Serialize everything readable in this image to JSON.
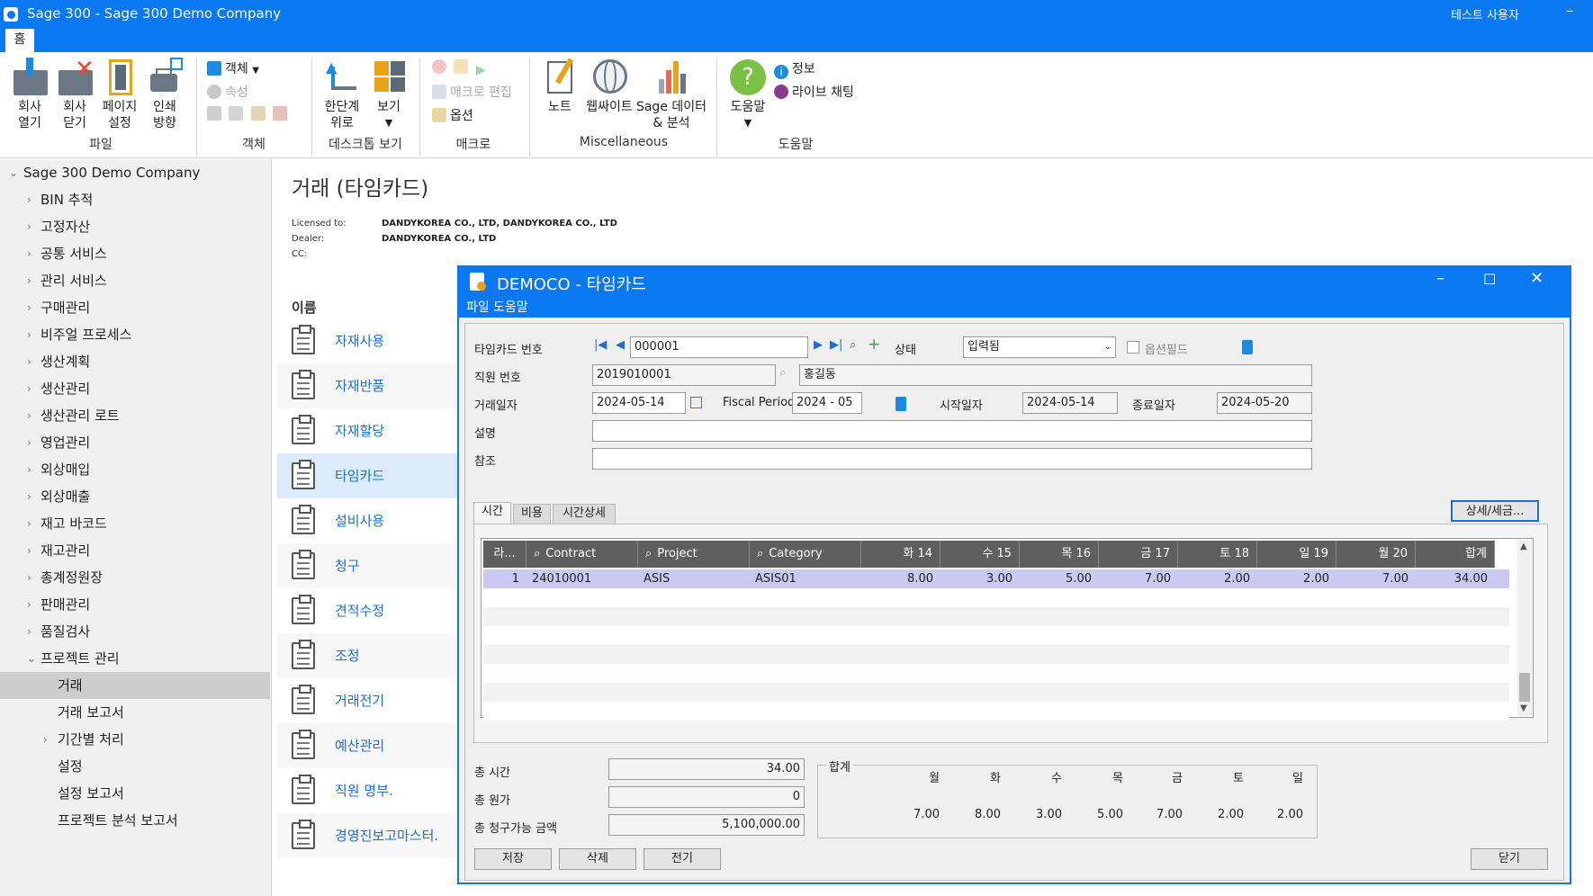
{
  "window": {
    "title": "Sage 300 - Sage 300 Demo Company",
    "user": "테스트 사용자",
    "minimize": "–"
  },
  "ribbon": {
    "tab_home": "홈",
    "file": {
      "open_company": "회사\n열기",
      "close_company": "회사\n닫기",
      "page_setup": "페이지\n설정",
      "print_dest": "인쇄\n방향",
      "group": "파일"
    },
    "object": {
      "object": "객체",
      "properties": "속성",
      "group": "객체"
    },
    "desktop": {
      "up_level": "한단계\n위로",
      "view": "보기",
      "group": "데스크톱 보기"
    },
    "macro": {
      "edit": "매크로 편집",
      "options": "옵션",
      "group": "매크로"
    },
    "misc": {
      "notes": "노트",
      "website": "웹싸이트",
      "sage_data": "Sage 데이터\n& 분석",
      "group": "Miscellaneous"
    },
    "help": {
      "help": "도움말",
      "info": "정보",
      "live_chat": "라이브 채팅",
      "group": "도움말"
    }
  },
  "sidebar": {
    "root": "Sage 300 Demo Company",
    "items": [
      "BIN 추적",
      "고정자산",
      "공통 서비스",
      "관리 서비스",
      "구매관리",
      "비주얼 프로세스",
      "생산계획",
      "생산관리",
      "생산관리 로트",
      "영업관리",
      "외상매입",
      "외상매출",
      "재고 바코드",
      "재고관리",
      "총계정원장",
      "판매관리",
      "품질검사",
      "프로젝트 관리"
    ],
    "sub": [
      "거래",
      "거래 보고서",
      "기간별 처리",
      "설정",
      "설정 보고서",
      "프로젝트 분석 보고서"
    ]
  },
  "page": {
    "title": "거래 (타임카드)",
    "licensed_to_label": "Licensed to:",
    "licensed_to": "DANDYKOREA CO., LTD, DANDYKOREA CO., LTD",
    "dealer_label": "Dealer:",
    "dealer": "DANDYKOREA CO., LTD",
    "cc_label": "CC:",
    "name_header": "이름",
    "items": [
      "자재사용",
      "자재반품",
      "자재할당",
      "타임카드",
      "설비사용",
      "청구",
      "견적수정",
      "조정",
      "거래전기",
      "예산관리",
      "직원 명부.",
      "경영진보고마스터."
    ]
  },
  "dialog": {
    "title": "DEMOCO - 타임카드",
    "menu": [
      "파일",
      "도움말"
    ],
    "timecard_no_label": "타임카드 번호",
    "timecard_no": "000001",
    "status_label": "상태",
    "status": "입력됨",
    "optional_fields": "옵션필드",
    "employee_label": "직원 번호",
    "employee_no": "2019010001",
    "employee_name": "홍길동",
    "trans_date_label": "거래일자",
    "trans_date": "2024-05-14",
    "fiscal_label": "Fiscal Period",
    "fiscal": "2024 - 05",
    "start_label": "시작일자",
    "start_date": "2024-05-14",
    "end_label": "종료일자",
    "end_date": "2024-05-20",
    "desc_label": "설명",
    "ref_label": "참조",
    "tabs": [
      "시간",
      "비용",
      "시간상세"
    ],
    "detail_button": "상세/세금...",
    "grid": {
      "headers": [
        "라...",
        "Contract",
        "Project",
        "Category",
        "화 14",
        "수 15",
        "목 16",
        "금 17",
        "토 18",
        "일 19",
        "월 20",
        "합계"
      ],
      "rows": [
        [
          "1",
          "24010001",
          "ASIS",
          "ASIS01",
          "8.00",
          "3.00",
          "5.00",
          "7.00",
          "2.00",
          "2.00",
          "7.00",
          "34.00"
        ]
      ]
    },
    "total_hours_label": "총 시간",
    "total_hours": "34.00",
    "total_cost_label": "총 원가",
    "total_cost": "0",
    "total_billable_label": "총 청구가능 금액",
    "total_billable": "5,100,000.00",
    "totals_title": "합계",
    "days": [
      "월",
      "화",
      "수",
      "목",
      "금",
      "토",
      "일"
    ],
    "day_totals": [
      "7.00",
      "8.00",
      "3.00",
      "5.00",
      "7.00",
      "2.00",
      "2.00"
    ],
    "buttons": {
      "save": "저장",
      "delete": "삭제",
      "post": "전기",
      "close": "닫기"
    }
  }
}
